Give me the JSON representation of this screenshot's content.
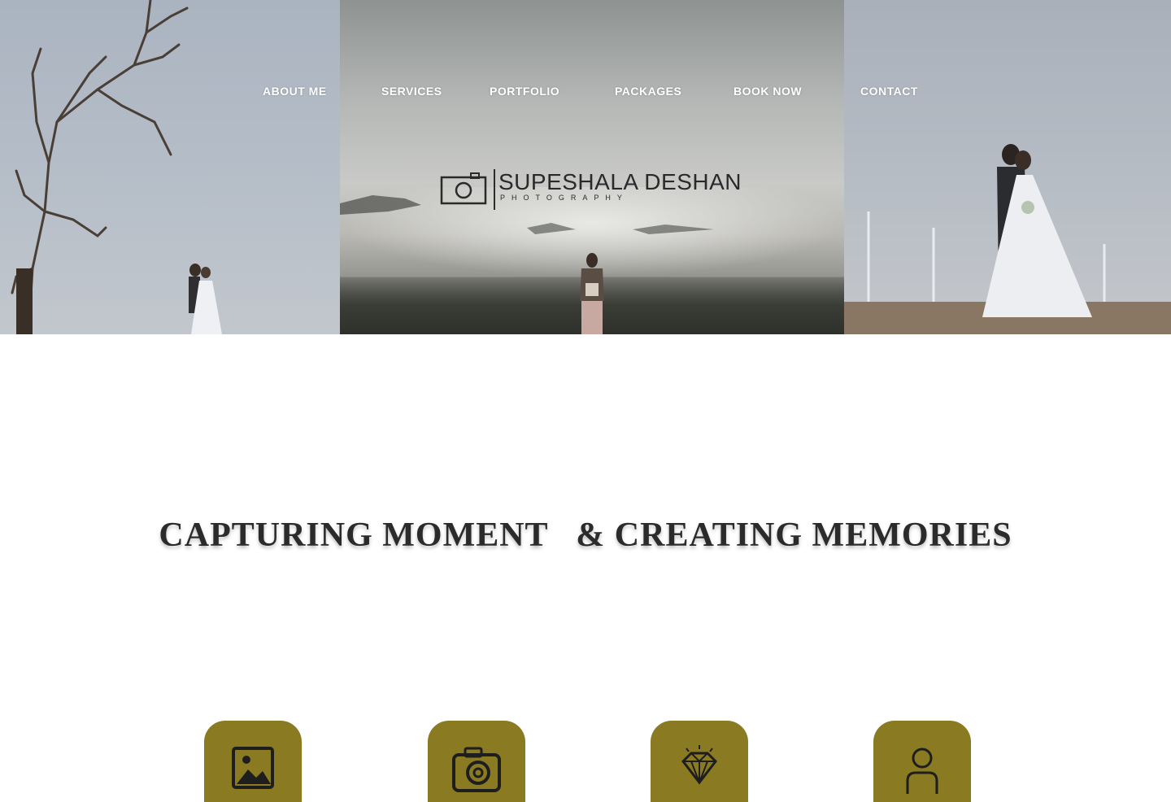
{
  "nav": {
    "items": [
      {
        "label": "ABOUT ME"
      },
      {
        "label": "SERVICES"
      },
      {
        "label": "PORTFOLIO"
      },
      {
        "label": "PACKAGES"
      },
      {
        "label": "BOOK NOW"
      },
      {
        "label": "CONTACT"
      }
    ]
  },
  "logo": {
    "name": "SUPESHALA DESHAN",
    "subtitle": "PHOTOGRAPHY"
  },
  "tagline": "CAPTURING MOMENT   & CREATING MEMORIES",
  "services": [
    {
      "icon": "gallery-icon"
    },
    {
      "icon": "camera-icon"
    },
    {
      "icon": "diamond-icon"
    },
    {
      "icon": "person-icon"
    }
  ],
  "colors": {
    "accent": "#8a7b22",
    "nav_text": "#ffffff",
    "heading": "#2b2b2b"
  }
}
